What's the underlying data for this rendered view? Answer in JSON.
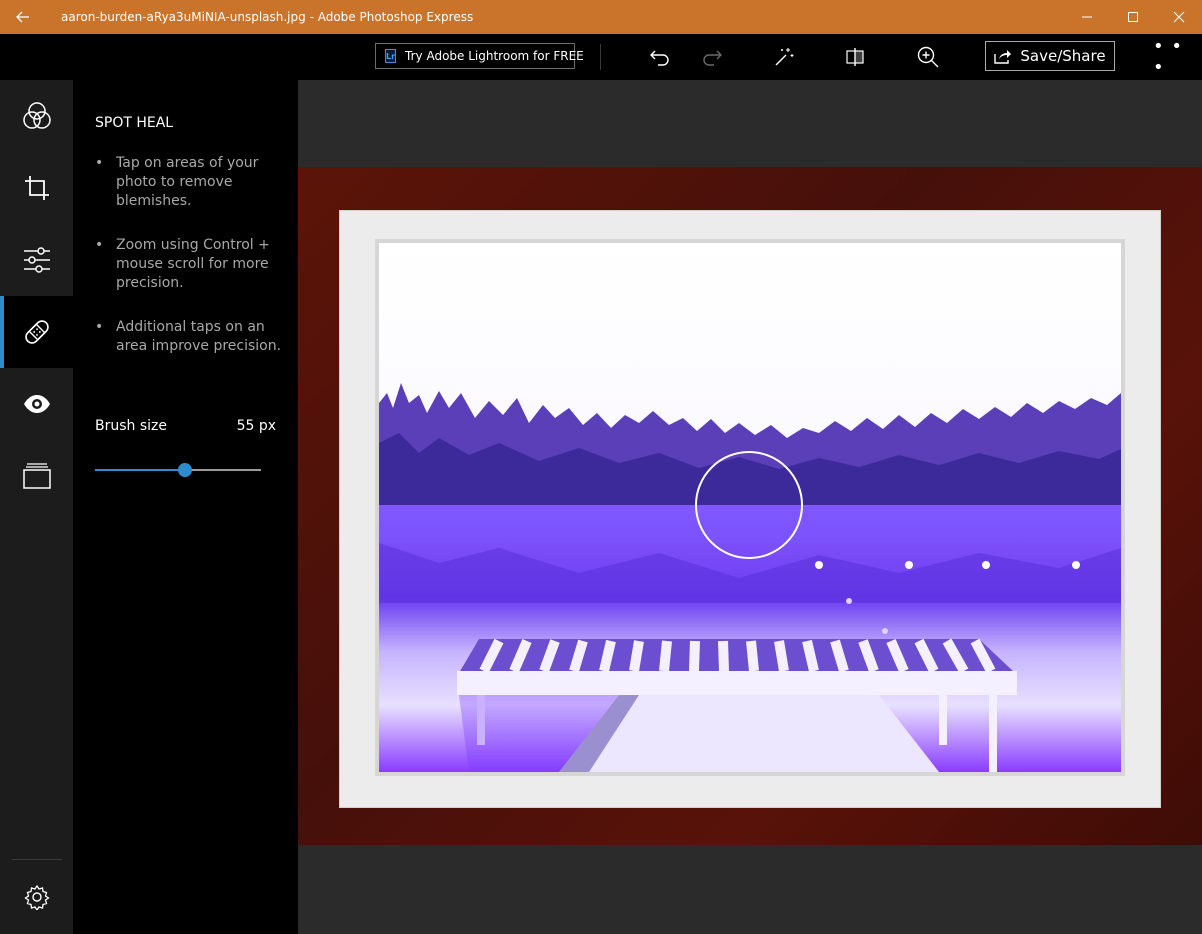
{
  "window": {
    "title": "aaron-burden-aRya3uMiNIA-unsplash.jpg - Adobe Photoshop Express",
    "back_icon": "arrow-left-icon",
    "controls": [
      "minimize-icon",
      "maximize-icon",
      "close-icon"
    ]
  },
  "toolbar": {
    "lightroom_badge": "Lr",
    "lightroom_label": "Try Adobe Lightroom for FREE",
    "tools": [
      "undo-icon",
      "redo-icon",
      "magic-wand-icon",
      "compare-icon",
      "zoom-in-icon"
    ],
    "save_label": "Save/Share",
    "more_label": "• • •"
  },
  "rail": {
    "items": [
      "looks-icon",
      "crop-icon",
      "adjustments-icon",
      "spot-heal-icon",
      "red-eye-icon",
      "borders-icon"
    ],
    "active": "spot-heal-icon",
    "settings": "settings-icon"
  },
  "panel": {
    "title": "SPOT HEAL",
    "tips": [
      "Tap on areas of your photo to remove blemishes.",
      "Zoom using Control + mouse scroll for more precision.",
      "Additional taps on an area improve precision."
    ],
    "brush_label": "Brush size",
    "brush_value": "55 px",
    "brush_level_fraction": 0.54
  },
  "colors": {
    "titlebar": "#c9742a",
    "accent": "#2d8ccf",
    "frame": "#5c1408",
    "photo_tint": "#7b3cff"
  }
}
